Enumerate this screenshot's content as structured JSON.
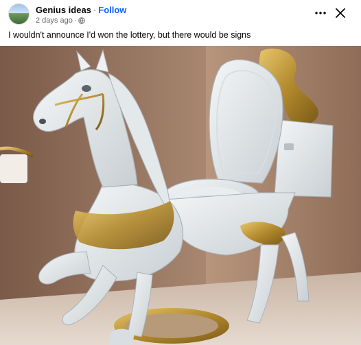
{
  "post": {
    "author": "Genius ideas",
    "separator": "·",
    "follow_label": "Follow",
    "time_ago": "2 days ago",
    "meta_dot": "·",
    "caption": "I wouldn't announce I'd won the lottery, but there would be signs"
  },
  "icons": {
    "more": "more-horizontal-icon",
    "close": "close-icon",
    "audience": "globe-icon"
  },
  "colors": {
    "link": "#0866ff",
    "meta": "#65676b",
    "text": "#050505"
  }
}
